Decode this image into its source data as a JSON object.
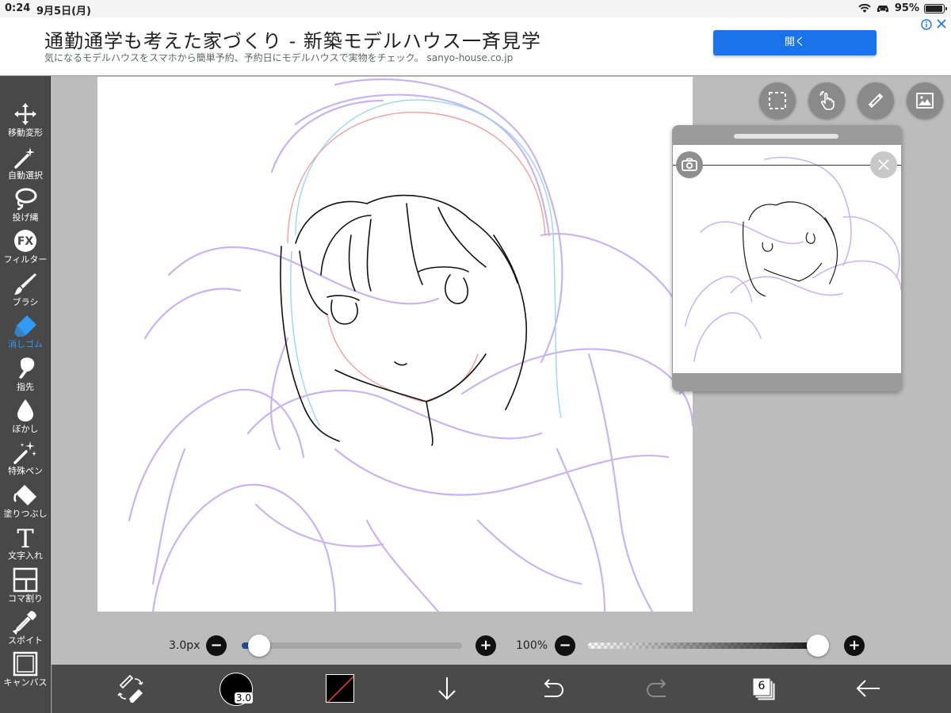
{
  "status_bar": {
    "time": "0:24",
    "date": "9月5日(月)",
    "battery": "95%"
  },
  "ad": {
    "title": "通勤通学も考えた家づくり - 新築モデルハウス一斉見学",
    "subtitle": "気になるモデルハウスをスマホから簡単予約、予約日にモデルハウスで実物をチェック。 sanyo-house.co.jp",
    "button_label": "開く",
    "adchoices_icons": [
      "info-icon",
      "close-icon"
    ]
  },
  "toolbar": {
    "active_color": "#2f9bf4",
    "tools": [
      {
        "label": "移動変形",
        "icon": "move-arrows-icon",
        "active": false
      },
      {
        "label": "自動選択",
        "icon": "magic-wand-icon",
        "active": false
      },
      {
        "label": "投げ縄",
        "icon": "lasso-icon",
        "active": false
      },
      {
        "label": "フィルター",
        "icon": "fx-filter-icon",
        "active": false
      },
      {
        "label": "ブラシ",
        "icon": "brush-icon",
        "active": false
      },
      {
        "label": "消しゴム",
        "icon": "eraser-icon",
        "active": true
      },
      {
        "label": "指先",
        "icon": "smudge-icon",
        "active": false
      },
      {
        "label": "ぼかし",
        "icon": "blur-drop-icon",
        "active": false
      },
      {
        "label": "特殊ペン",
        "icon": "special-pen-icon",
        "active": false
      },
      {
        "label": "塗りつぶし",
        "icon": "fill-bucket-icon",
        "active": false
      },
      {
        "label": "文字入れ",
        "icon": "text-icon",
        "active": false
      },
      {
        "label": "コマ割り",
        "icon": "panel-divide-icon",
        "active": false
      },
      {
        "label": "スポイト",
        "icon": "eyedropper-icon",
        "active": false
      },
      {
        "label": "キャンバス",
        "icon": "canvas-icon",
        "active": false
      }
    ]
  },
  "canvas_buttons": [
    "selection-icon",
    "touch-gesture-icon",
    "ruler-icon",
    "image-import-icon"
  ],
  "navigator": {
    "icons": [
      "camera-icon",
      "close-icon"
    ]
  },
  "brush_size": {
    "value_label": "3.0px",
    "minus": "−",
    "plus": "+",
    "level": 0.03
  },
  "opacity": {
    "value_label": "100%",
    "minus": "−",
    "plus": "+",
    "level": 1.0
  },
  "bottom_bar": {
    "brush_size_badge": "3.0",
    "layer_count": "6",
    "primary_color": "#000000",
    "icons": [
      "tool-swap-icon",
      "brush-preview-icon",
      "color-swatch-icon",
      "download-icon",
      "undo-icon",
      "redo-icon",
      "layers-icon",
      "back-arrow-icon"
    ]
  }
}
